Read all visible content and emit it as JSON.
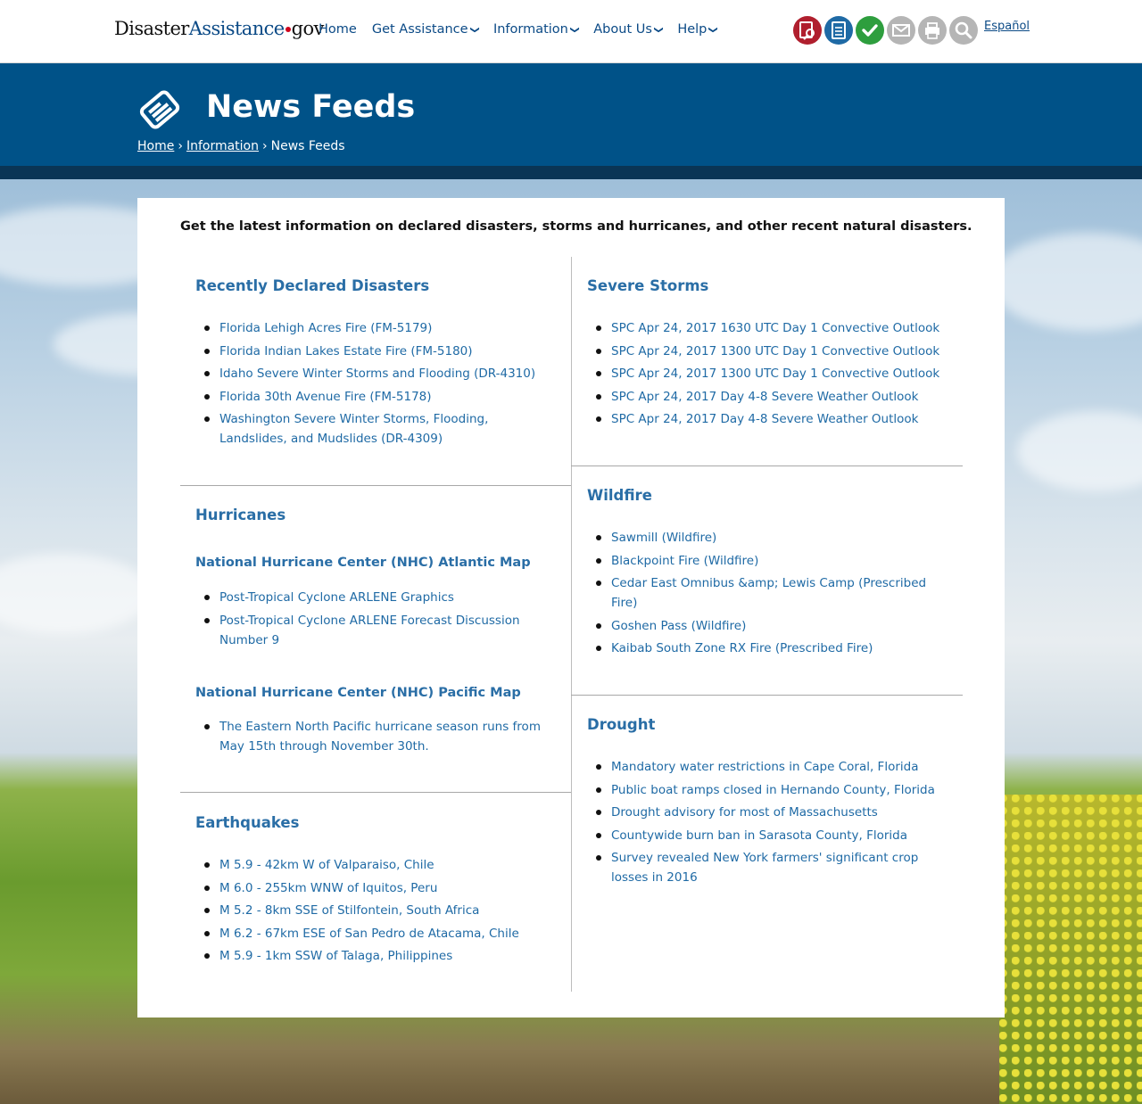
{
  "header": {
    "logo": {
      "part1": "Disaster",
      "part2": "Assistance",
      "part3": "gov"
    },
    "nav": [
      {
        "label": "Home",
        "dropdown": false
      },
      {
        "label": "Get Assistance",
        "dropdown": true
      },
      {
        "label": "Information",
        "dropdown": true
      },
      {
        "label": "About Us",
        "dropdown": true
      },
      {
        "label": "Help",
        "dropdown": true
      }
    ],
    "tools": [
      {
        "icon": "find-assistance-icon",
        "color": "#b01f2e"
      },
      {
        "icon": "apply-online-icon",
        "color": "#1f6aa5"
      },
      {
        "icon": "check-status-icon",
        "color": "#2e9e3e"
      },
      {
        "icon": "email-icon",
        "color": "#b5b5b5"
      },
      {
        "icon": "print-icon",
        "color": "#b5b5b5"
      },
      {
        "icon": "search-icon",
        "color": "#b5b5b5"
      }
    ],
    "language_link": "Español"
  },
  "banner": {
    "title": "News Feeds",
    "breadcrumb": {
      "home": "Home",
      "information": "Information",
      "current": "News Feeds",
      "separator": "›"
    }
  },
  "intro": "Get the latest information on declared disasters, storms and hurricanes, and other recent natural disasters.",
  "sections": {
    "declared": {
      "title": "Recently Declared Disasters",
      "items": [
        [
          "Florida Lehigh Acres Fire (FM-5179)"
        ],
        [
          "Florida Indian Lakes Estate Fire (FM-5180)"
        ],
        [
          "Idaho Severe Winter Storms and Flooding (DR-4310)"
        ],
        [
          "Florida 30th Avenue Fire (FM-5178)"
        ],
        [
          "Washington Severe Winter Storms, Flooding,",
          "Landslides, and Mudslides (DR-4309)"
        ]
      ]
    },
    "hurricanes": {
      "title": "Hurricanes",
      "atlantic_title": "National Hurricane Center (NHC) Atlantic Map",
      "atlantic_items": [
        [
          "Post-Tropical Cyclone ARLENE Graphics"
        ],
        [
          "Post-Tropical Cyclone ARLENE Forecast Discussion",
          "Number 9"
        ]
      ],
      "pacific_title": "National Hurricane Center (NHC) Pacific Map",
      "pacific_items": [
        [
          "The Eastern North Pacific hurricane season runs from",
          "May 15th through November 30th."
        ]
      ]
    },
    "earthquakes": {
      "title": "Earthquakes",
      "items": [
        [
          "M 5.9 - 42km W of Valparaiso, Chile"
        ],
        [
          "M 6.0 - 255km WNW of Iquitos, Peru"
        ],
        [
          "M 5.2 - 8km SSE of Stilfontein, South Africa"
        ],
        [
          "M 6.2 - 67km ESE of San Pedro de Atacama, Chile"
        ],
        [
          "M 5.9 - 1km SSW of Talaga, Philippines"
        ]
      ]
    },
    "storms": {
      "title": "Severe Storms",
      "items": [
        [
          "SPC Apr 24, 2017 1630 UTC Day 1 Convective Outlook"
        ],
        [
          "SPC Apr 24, 2017 1300 UTC Day 1 Convective Outlook"
        ],
        [
          "SPC Apr 24, 2017 1300 UTC Day 1 Convective Outlook"
        ],
        [
          "SPC Apr 24, 2017 Day 4-8 Severe Weather Outlook"
        ],
        [
          "SPC Apr 24, 2017 Day 4-8 Severe Weather Outlook"
        ]
      ]
    },
    "wildfire": {
      "title": "Wildfire",
      "items": [
        [
          "Sawmill (Wildfire)"
        ],
        [
          "Blackpoint Fire (Wildfire)"
        ],
        [
          "Cedar East Omnibus &amp; Lewis Camp (Prescribed",
          "Fire)"
        ],
        [
          "Goshen Pass (Wildfire)"
        ],
        [
          "Kaibab South Zone RX Fire (Prescribed Fire)"
        ]
      ]
    },
    "drought": {
      "title": "Drought",
      "items": [
        [
          "Mandatory water restrictions in Cape Coral, Florida"
        ],
        [
          "Public boat ramps closed in Hernando County, Florida"
        ],
        [
          "Drought advisory for most of Massachusetts"
        ],
        [
          "Countywide burn ban in Sarasota County, Florida"
        ],
        [
          "Survey revealed New York farmers' significant crop",
          "losses in 2016"
        ]
      ]
    }
  }
}
